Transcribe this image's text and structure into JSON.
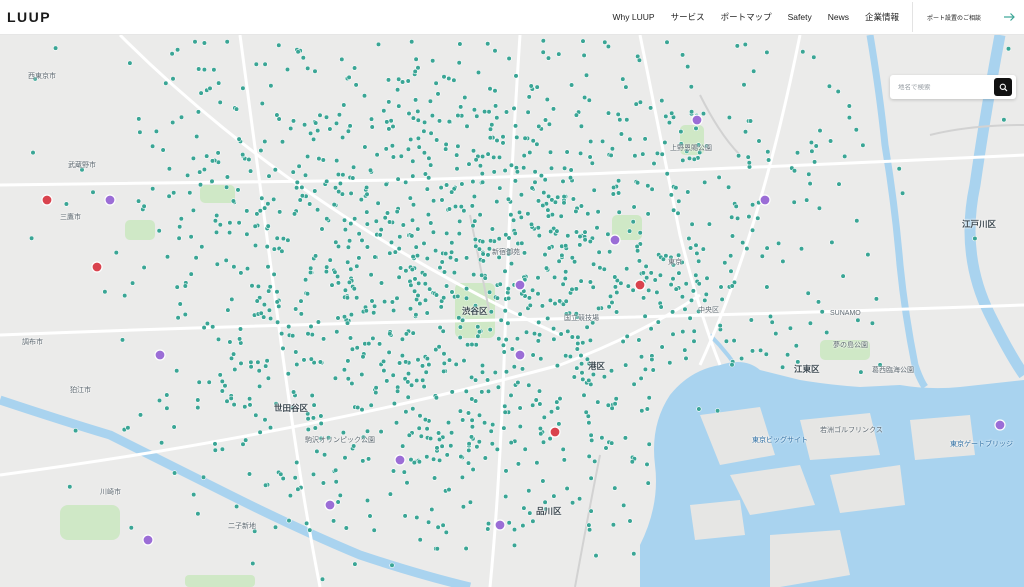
{
  "header": {
    "logo": "LUUP",
    "nav": [
      {
        "label": "Why LUUP"
      },
      {
        "label": "サービス"
      },
      {
        "label": "ポートマップ"
      },
      {
        "label": "Safety"
      },
      {
        "label": "News"
      },
      {
        "label": "企業情報"
      }
    ],
    "cta_label": "ポート設置のご相談"
  },
  "search": {
    "placeholder": "地名で検索"
  },
  "map": {
    "port_color": "#3aa595",
    "water_color": "#a9d3ef",
    "labels": [
      {
        "text": "西東京市",
        "kind": "place"
      },
      {
        "text": "武蔵野市",
        "kind": "place"
      },
      {
        "text": "三鷹市",
        "kind": "place"
      },
      {
        "text": "調布市",
        "kind": "place"
      },
      {
        "text": "狛江市",
        "kind": "place"
      },
      {
        "text": "世田谷区",
        "kind": "ward"
      },
      {
        "text": "渋谷区",
        "kind": "ward"
      },
      {
        "text": "港区",
        "kind": "ward"
      },
      {
        "text": "品川区",
        "kind": "ward"
      },
      {
        "text": "江東区",
        "kind": "ward"
      },
      {
        "text": "江戸川区",
        "kind": "ward"
      },
      {
        "text": "中央区",
        "kind": "place"
      },
      {
        "text": "東京",
        "kind": "place"
      },
      {
        "text": "新宿御苑",
        "kind": "place"
      },
      {
        "text": "上野恩賜公園",
        "kind": "place"
      },
      {
        "text": "夢の島公園",
        "kind": "place"
      },
      {
        "text": "東京ビッグサイト",
        "kind": "place"
      },
      {
        "text": "東京ゲートブリッジ",
        "kind": "place"
      },
      {
        "text": "若洲ゴルフリンクス",
        "kind": "place"
      },
      {
        "text": "葛西臨海公園",
        "kind": "place"
      },
      {
        "text": "川崎市",
        "kind": "place"
      },
      {
        "text": "二子新地",
        "kind": "place"
      },
      {
        "text": "駒沢オリンピック公園",
        "kind": "place"
      },
      {
        "text": "国立競技場",
        "kind": "place"
      },
      {
        "text": "SUNAMO",
        "kind": "place"
      }
    ]
  }
}
